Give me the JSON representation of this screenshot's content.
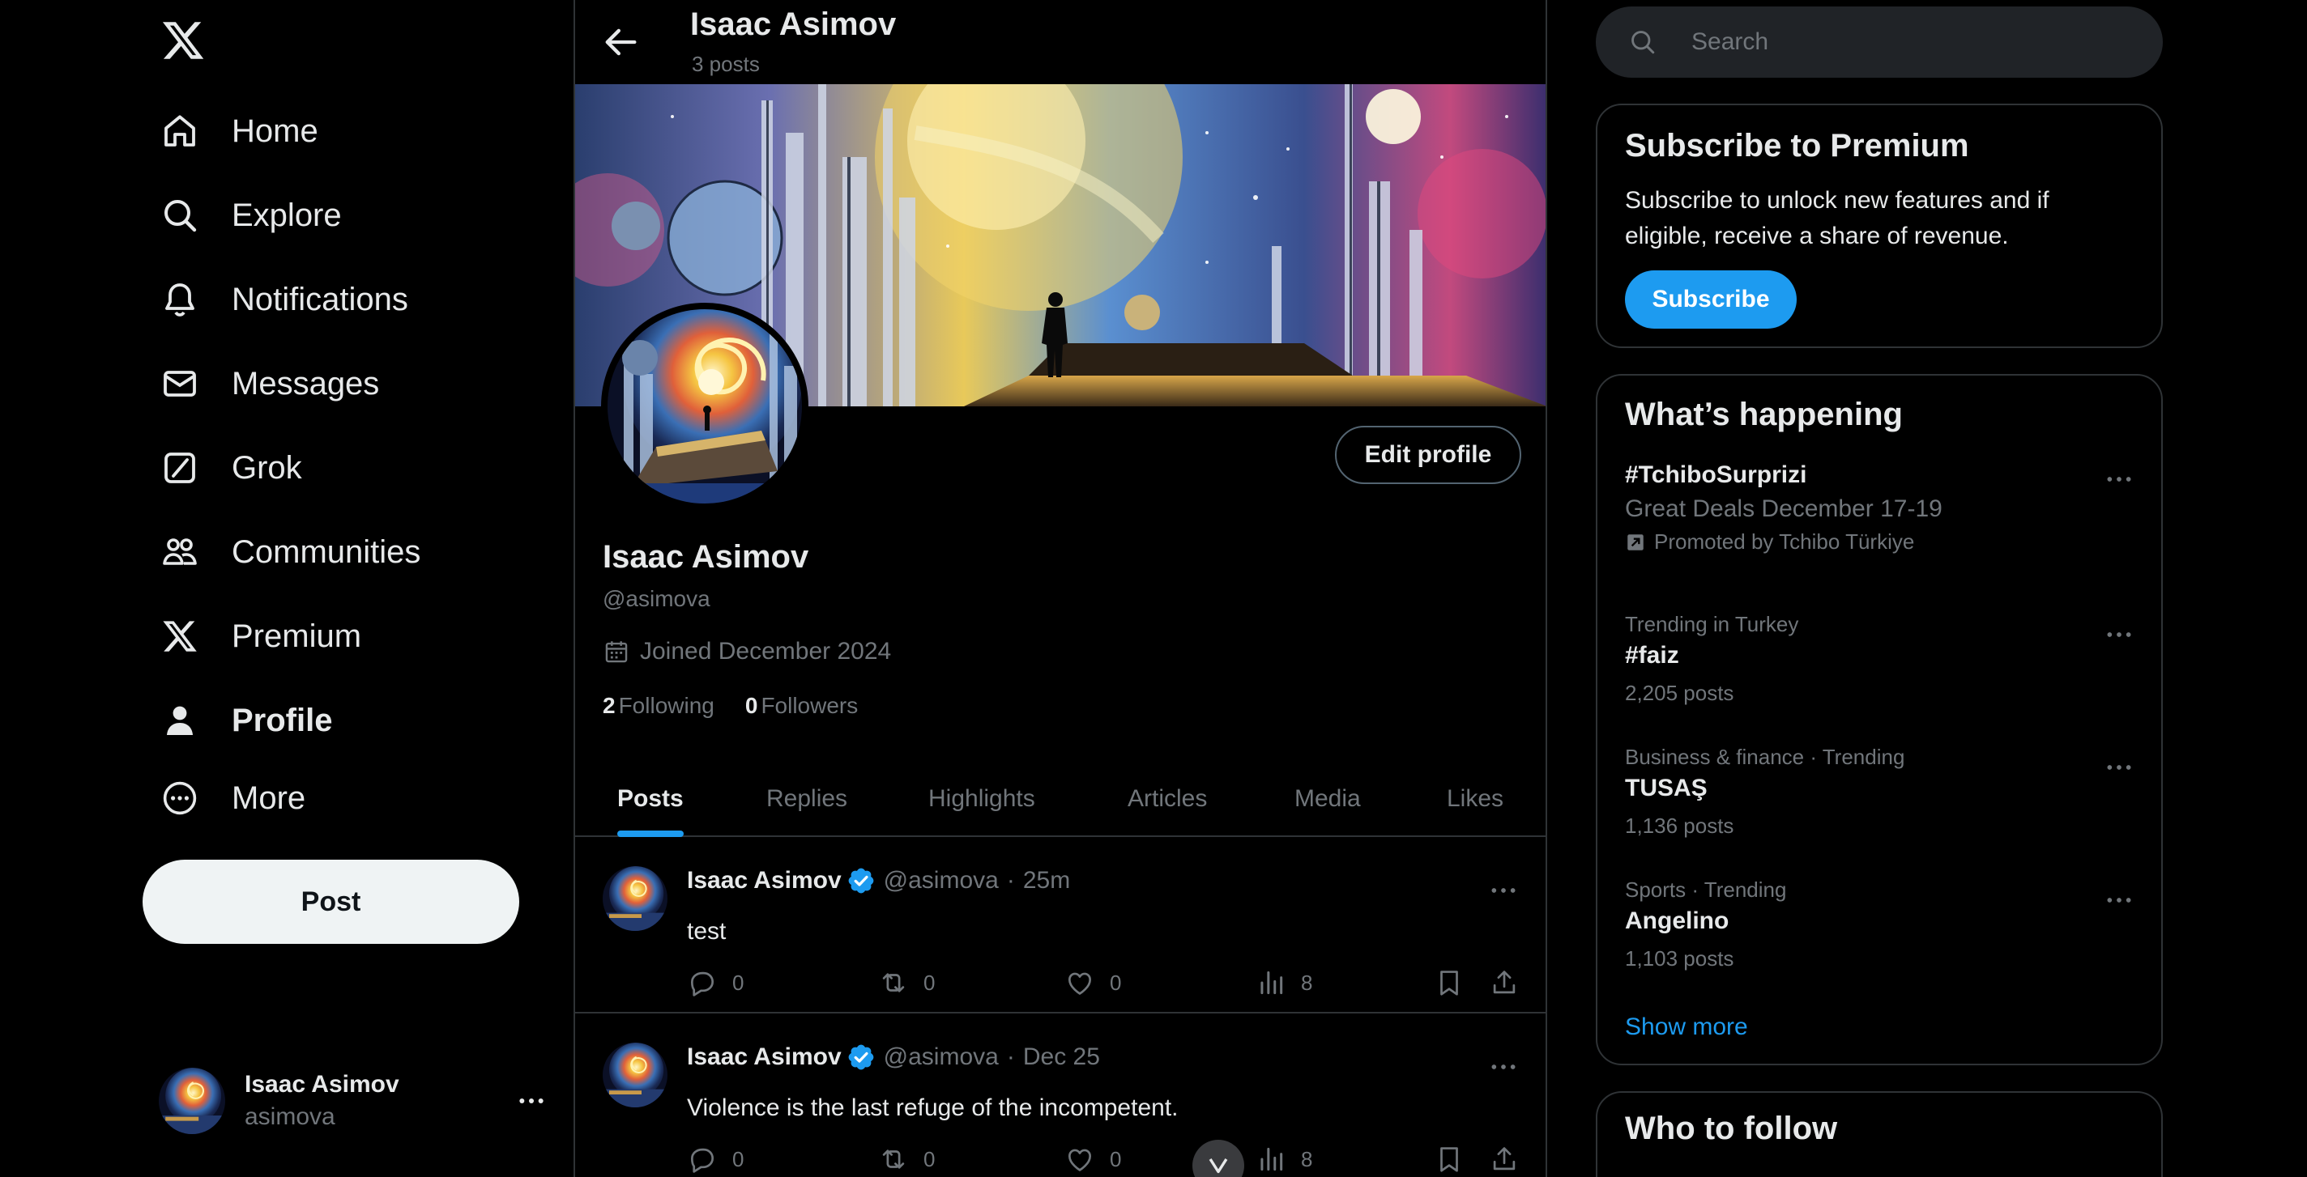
{
  "nav": {
    "items": [
      {
        "label": "Home",
        "icon": "home-icon"
      },
      {
        "label": "Explore",
        "icon": "search-icon"
      },
      {
        "label": "Notifications",
        "icon": "bell-icon"
      },
      {
        "label": "Messages",
        "icon": "envelope-icon"
      },
      {
        "label": "Grok",
        "icon": "grok-icon"
      },
      {
        "label": "Communities",
        "icon": "people-icon"
      },
      {
        "label": "Premium",
        "icon": "x-logo-icon"
      },
      {
        "label": "Profile",
        "icon": "person-icon",
        "active": true
      },
      {
        "label": "More",
        "icon": "more-circle-icon"
      }
    ],
    "post_label": "Post",
    "account": {
      "name": "Isaac Asimov",
      "handle": "asimova"
    }
  },
  "header": {
    "title": "Isaac Asimov",
    "subtitle": "3 posts"
  },
  "profile": {
    "name": "Isaac Asimov",
    "handle": "@asimova",
    "joined": "Joined December 2024",
    "following_count": "2",
    "following_label": "Following",
    "followers_count": "0",
    "followers_label": "Followers",
    "edit_label": "Edit profile"
  },
  "tabs": [
    "Posts",
    "Replies",
    "Highlights",
    "Articles",
    "Media",
    "Likes"
  ],
  "active_tab": "Posts",
  "posts": [
    {
      "name": "Isaac Asimov",
      "handle": "@asimova",
      "sep": "·",
      "time": "25m",
      "text": "test",
      "replies": "0",
      "reposts": "0",
      "likes": "0",
      "views": "8"
    },
    {
      "name": "Isaac Asimov",
      "handle": "@asimova",
      "sep": "·",
      "time": "Dec 25",
      "text": "Violence is the last refuge of the incompetent.",
      "replies": "0",
      "reposts": "0",
      "likes": "0",
      "views": "8"
    }
  ],
  "search": {
    "placeholder": "Search"
  },
  "premium": {
    "title": "Subscribe to Premium",
    "text": "Subscribe to unlock new features and if eligible, receive a share of revenue.",
    "button": "Subscribe"
  },
  "happening": {
    "title": "What’s happening",
    "promoted": {
      "name": "#TchiboSurprizi",
      "subtitle": "Great Deals December 17-19",
      "promo": "Promoted by Tchibo Türkiye"
    },
    "trends": [
      {
        "context": "Trending in Turkey",
        "name": "#faiz",
        "count": "2,205 posts"
      },
      {
        "context": "Business & finance · Trending",
        "name": "TUSAŞ",
        "count": "1,136 posts"
      },
      {
        "context": "Sports · Trending",
        "name": "Angelino",
        "count": "1,103 posts"
      }
    ],
    "show_more": "Show more"
  },
  "who_to_follow": {
    "title": "Who to follow"
  },
  "colors": {
    "accent": "#1d9bf0",
    "background": "#000000",
    "border": "#2f3336",
    "muted": "#71767b",
    "text": "#e7e9ea"
  }
}
